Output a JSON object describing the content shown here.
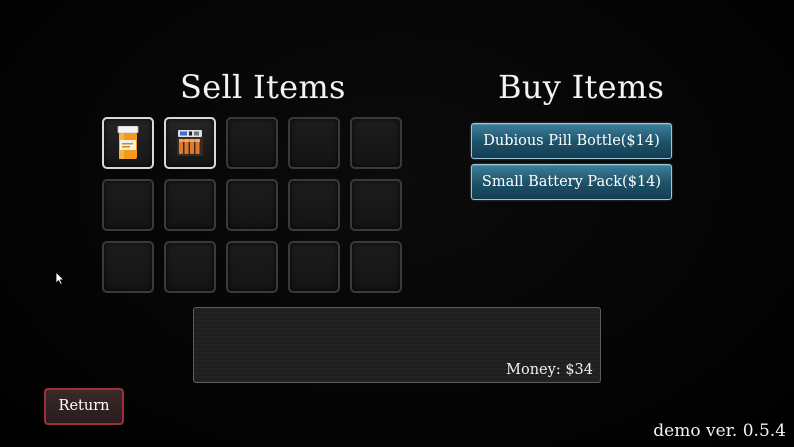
{
  "sell": {
    "title": "Sell Items",
    "slots": [
      {
        "item": "pill-bottle-icon",
        "filled": true
      },
      {
        "item": "battery-pack-icon",
        "filled": true
      },
      {
        "item": null,
        "filled": false
      },
      {
        "item": null,
        "filled": false
      },
      {
        "item": null,
        "filled": false
      },
      {
        "item": null,
        "filled": false
      },
      {
        "item": null,
        "filled": false
      },
      {
        "item": null,
        "filled": false
      },
      {
        "item": null,
        "filled": false
      },
      {
        "item": null,
        "filled": false
      },
      {
        "item": null,
        "filled": false
      },
      {
        "item": null,
        "filled": false
      },
      {
        "item": null,
        "filled": false
      },
      {
        "item": null,
        "filled": false
      },
      {
        "item": null,
        "filled": false
      }
    ]
  },
  "buy": {
    "title": "Buy Items",
    "items": [
      {
        "label": "Dubious Pill Bottle($14)"
      },
      {
        "label": "Small Battery Pack($14)"
      }
    ]
  },
  "info": {
    "money_label": "Money: $34"
  },
  "return_label": "Return",
  "version_label": "demo ver. 0.5.4",
  "colors": {
    "buy_button": "#1d5168",
    "return_border": "#9c2f37",
    "slot_border": "#3a3a3a",
    "slot_filled_border": "#d9d9d9"
  }
}
